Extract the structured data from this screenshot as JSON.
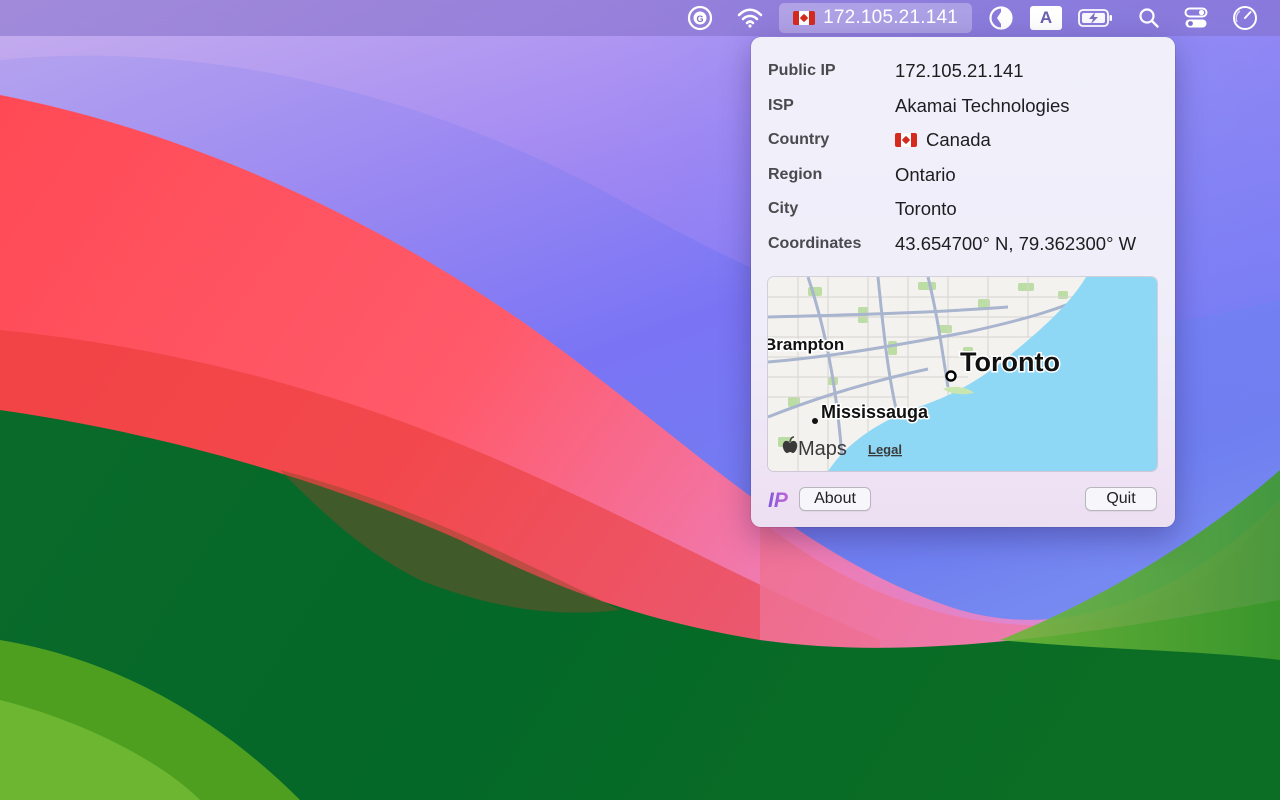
{
  "menubar": {
    "icons": [
      "g-badge-icon",
      "wifi-icon",
      "half-circle-icon",
      "input-source-icon",
      "battery-charging-icon",
      "search-icon",
      "control-center-icon",
      "gauge-icon"
    ],
    "ip_text": "172.105.21.141",
    "input_source_letter": "A"
  },
  "popup": {
    "rows": [
      {
        "label": "Public IP",
        "value": "172.105.21.141"
      },
      {
        "label": "ISP",
        "value": "Akamai Technologies"
      },
      {
        "label": "Country",
        "value": "Canada"
      },
      {
        "label": "Region",
        "value": "Ontario"
      },
      {
        "label": "City",
        "value": "Toronto"
      },
      {
        "label": "Coordinates",
        "value": "43.654700° N, 79.362300° W"
      }
    ],
    "map": {
      "labels": {
        "toronto": "Toronto",
        "brampton": "Brampton",
        "mississauga": "Mississauga"
      },
      "brand": "Maps",
      "legal": "Legal"
    },
    "logo": "IP",
    "about_label": "About",
    "quit_label": "Quit"
  },
  "colors": {
    "water": "#8fd8f5",
    "land": "#f3f2ee",
    "parks": "#b7dba0",
    "flag_red": "#d52b1e",
    "popup_bg": "#f1f0fa"
  }
}
